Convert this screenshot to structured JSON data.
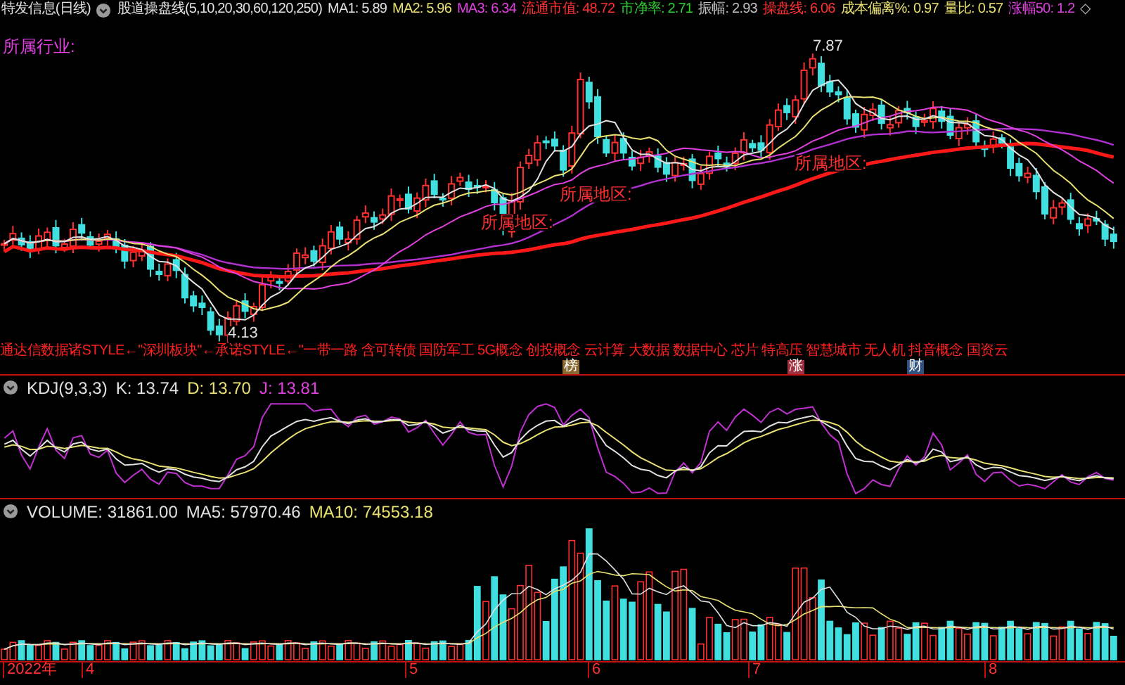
{
  "header": {
    "title": "特发信息(日线)",
    "indicator": "股道操盘线(5,10,20,30,60,120,250)",
    "values": [
      {
        "text": "MA1: 5.89",
        "color": "#e0e0e0"
      },
      {
        "text": "MA2: 5.96",
        "color": "#e8e070"
      },
      {
        "text": "MA3: 6.34",
        "color": "#e040e0"
      },
      {
        "text": "流通市值: 48.72",
        "color": "#ff3030"
      },
      {
        "text": "市净率: 2.71",
        "color": "#30d030"
      },
      {
        "text": "振幅: 2.93",
        "color": "#c0c0c0"
      },
      {
        "text": "操盘线: 6.06",
        "color": "#ff3030"
      },
      {
        "text": "成本偏离%: 0.97",
        "color": "#e8e070"
      },
      {
        "text": "量比: 0.57",
        "color": "#e8e070"
      },
      {
        "text": "涨幅50: 1.2",
        "color": "#e040e0"
      }
    ],
    "end_mark": "◇"
  },
  "price_panel": {
    "industry_label": "所属行业:",
    "region_labels": [
      "所属地区:",
      "所属地区:",
      "所属地区:"
    ],
    "high_mark": "7.87",
    "low_mark": "4.13",
    "concepts": "通达信数据诸STYLE←\"深圳板块\"←承诺STYLE←\"一带一路 含可转债 国防军工 5G概念 创投概念 云计算 大数据 数据中心 芯片 特高压 智慧城市 无人机 抖音概念 国资云",
    "badges": [
      {
        "text": "榜",
        "color": "#8a6a30"
      },
      {
        "text": "涨",
        "color": "#a03040"
      },
      {
        "text": "财",
        "color": "#305080"
      }
    ]
  },
  "kdj_panel": {
    "title": "KDJ(9,3,3)",
    "values": [
      {
        "text": "K: 13.74",
        "color": "#e0e0e0"
      },
      {
        "text": "D: 13.70",
        "color": "#e8e070"
      },
      {
        "text": "J: 13.81",
        "color": "#e040e0"
      }
    ]
  },
  "volume_panel": {
    "title": "VOLUME: 31861.00",
    "values": [
      {
        "text": "MA5: 57970.46",
        "color": "#e0e0e0"
      },
      {
        "text": "MA10: 74553.18",
        "color": "#e8e070"
      }
    ]
  },
  "date_axis": [
    "2022年",
    "4",
    "5",
    "6",
    "7",
    "8"
  ]
}
